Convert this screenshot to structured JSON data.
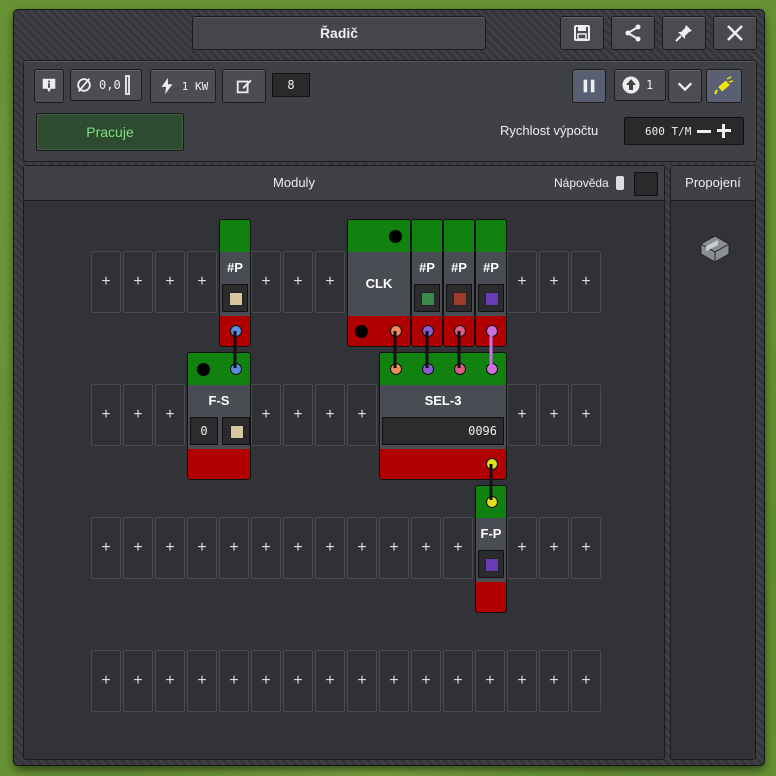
{
  "window": {
    "title": "Řadič"
  },
  "titlebar": {
    "icons": [
      "save-icon",
      "share-icon",
      "pin-icon",
      "close-icon"
    ]
  },
  "toolbar": {
    "power_value": "0,0",
    "energy_value": "1 KW",
    "edit_value": "8",
    "step_value": "1",
    "status": "Pracuje",
    "speed_label": "Rychlost výpočtu",
    "speed_value": "600 T/M"
  },
  "modules_panel": {
    "title": "Moduly",
    "help_label": "Nápověda"
  },
  "connections_panel": {
    "title": "Propojení"
  },
  "slots": {
    "plus": "+"
  },
  "modules": {
    "p1": "#P",
    "clk": "CLK",
    "p2": "#P",
    "p3": "#P",
    "p4": "#P",
    "fs": "F-S",
    "fs_value": "0",
    "sel": "SEL-3",
    "sel_value": "0096",
    "fp": "F-P"
  },
  "colors": {
    "port_blue": "#5a8de0",
    "port_orange": "#f08a5a",
    "port_purple": "#8a5ad8",
    "port_pink": "#e05a8a",
    "port_magenta": "#d070e0",
    "port_yellow": "#e0e020",
    "status_green": "#7fe07f"
  }
}
